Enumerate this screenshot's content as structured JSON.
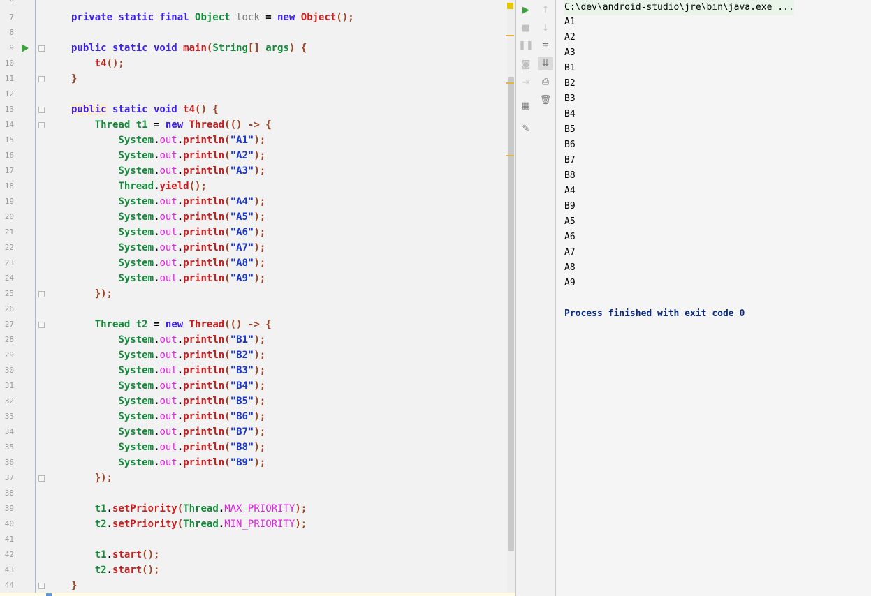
{
  "editor": {
    "first_line_number": "6",
    "lines": [
      {
        "n": "7",
        "tokens": [
          [
            "kw",
            "private static final "
          ],
          [
            "tp",
            "Object "
          ],
          [
            "var",
            "lock "
          ],
          [
            "op",
            "= "
          ],
          [
            "kw",
            "new "
          ],
          [
            "fn",
            "Object"
          ],
          [
            "pn",
            "();"
          ]
        ]
      },
      {
        "n": "8",
        "tokens": []
      },
      {
        "n": "9",
        "tokens": [
          [
            "kw",
            "public static void "
          ],
          [
            "fn",
            "main"
          ],
          [
            "pn",
            "("
          ],
          [
            "tp",
            "String"
          ],
          [
            "pn",
            "[] "
          ],
          [
            "tp",
            "args"
          ],
          [
            "pn",
            ") {"
          ]
        ]
      },
      {
        "n": "10",
        "tokens": [
          [
            "op",
            "    "
          ],
          [
            "fn",
            "t4"
          ],
          [
            "pn",
            "();"
          ]
        ]
      },
      {
        "n": "11",
        "tokens": [
          [
            "pn",
            "}"
          ]
        ]
      },
      {
        "n": "12",
        "tokens": []
      },
      {
        "n": "13",
        "tokens": [
          [
            "kwhl",
            "public"
          ],
          [
            "kw",
            " static void "
          ],
          [
            "fn",
            "t4"
          ],
          [
            "pn",
            "() {"
          ]
        ]
      },
      {
        "n": "14",
        "tokens": [
          [
            "op",
            "    "
          ],
          [
            "tp",
            "Thread "
          ],
          [
            "tp",
            "t1 "
          ],
          [
            "op",
            "= "
          ],
          [
            "kw",
            "new "
          ],
          [
            "fn",
            "Thread"
          ],
          [
            "pn",
            "(() -> {"
          ]
        ]
      },
      {
        "n": "15",
        "tokens": [
          [
            "op",
            "        "
          ],
          [
            "tp",
            "System"
          ],
          [
            "op",
            "."
          ],
          [
            "fld",
            "out"
          ],
          [
            "op",
            "."
          ],
          [
            "fn",
            "println"
          ],
          [
            "pn",
            "("
          ],
          [
            "str",
            "\"A1\""
          ],
          [
            "pn",
            ");"
          ]
        ]
      },
      {
        "n": "16",
        "tokens": [
          [
            "op",
            "        "
          ],
          [
            "tp",
            "System"
          ],
          [
            "op",
            "."
          ],
          [
            "fld",
            "out"
          ],
          [
            "op",
            "."
          ],
          [
            "fn",
            "println"
          ],
          [
            "pn",
            "("
          ],
          [
            "str",
            "\"A2\""
          ],
          [
            "pn",
            ");"
          ]
        ]
      },
      {
        "n": "17",
        "tokens": [
          [
            "op",
            "        "
          ],
          [
            "tp",
            "System"
          ],
          [
            "op",
            "."
          ],
          [
            "fld",
            "out"
          ],
          [
            "op",
            "."
          ],
          [
            "fn",
            "println"
          ],
          [
            "pn",
            "("
          ],
          [
            "str",
            "\"A3\""
          ],
          [
            "pn",
            ");"
          ]
        ]
      },
      {
        "n": "18",
        "tokens": [
          [
            "op",
            "        "
          ],
          [
            "tp",
            "Thread"
          ],
          [
            "op",
            "."
          ],
          [
            "fn",
            "yield"
          ],
          [
            "pn",
            "();"
          ]
        ]
      },
      {
        "n": "19",
        "tokens": [
          [
            "op",
            "        "
          ],
          [
            "tp",
            "System"
          ],
          [
            "op",
            "."
          ],
          [
            "fld",
            "out"
          ],
          [
            "op",
            "."
          ],
          [
            "fn",
            "println"
          ],
          [
            "pn",
            "("
          ],
          [
            "str",
            "\"A4\""
          ],
          [
            "pn",
            ");"
          ]
        ]
      },
      {
        "n": "20",
        "tokens": [
          [
            "op",
            "        "
          ],
          [
            "tp",
            "System"
          ],
          [
            "op",
            "."
          ],
          [
            "fld",
            "out"
          ],
          [
            "op",
            "."
          ],
          [
            "fn",
            "println"
          ],
          [
            "pn",
            "("
          ],
          [
            "str",
            "\"A5\""
          ],
          [
            "pn",
            ");"
          ]
        ]
      },
      {
        "n": "21",
        "tokens": [
          [
            "op",
            "        "
          ],
          [
            "tp",
            "System"
          ],
          [
            "op",
            "."
          ],
          [
            "fld",
            "out"
          ],
          [
            "op",
            "."
          ],
          [
            "fn",
            "println"
          ],
          [
            "pn",
            "("
          ],
          [
            "str",
            "\"A6\""
          ],
          [
            "pn",
            ");"
          ]
        ]
      },
      {
        "n": "22",
        "tokens": [
          [
            "op",
            "        "
          ],
          [
            "tp",
            "System"
          ],
          [
            "op",
            "."
          ],
          [
            "fld",
            "out"
          ],
          [
            "op",
            "."
          ],
          [
            "fn",
            "println"
          ],
          [
            "pn",
            "("
          ],
          [
            "str",
            "\"A7\""
          ],
          [
            "pn",
            ");"
          ]
        ]
      },
      {
        "n": "23",
        "tokens": [
          [
            "op",
            "        "
          ],
          [
            "tp",
            "System"
          ],
          [
            "op",
            "."
          ],
          [
            "fld",
            "out"
          ],
          [
            "op",
            "."
          ],
          [
            "fn",
            "println"
          ],
          [
            "pn",
            "("
          ],
          [
            "str",
            "\"A8\""
          ],
          [
            "pn",
            ");"
          ]
        ]
      },
      {
        "n": "24",
        "tokens": [
          [
            "op",
            "        "
          ],
          [
            "tp",
            "System"
          ],
          [
            "op",
            "."
          ],
          [
            "fld",
            "out"
          ],
          [
            "op",
            "."
          ],
          [
            "fn",
            "println"
          ],
          [
            "pn",
            "("
          ],
          [
            "str",
            "\"A9\""
          ],
          [
            "pn",
            ");"
          ]
        ]
      },
      {
        "n": "25",
        "tokens": [
          [
            "op",
            "    "
          ],
          [
            "pn",
            "});"
          ]
        ]
      },
      {
        "n": "26",
        "tokens": []
      },
      {
        "n": "27",
        "tokens": [
          [
            "op",
            "    "
          ],
          [
            "tp",
            "Thread "
          ],
          [
            "tp",
            "t2 "
          ],
          [
            "op",
            "= "
          ],
          [
            "kw",
            "new "
          ],
          [
            "fn",
            "Thread"
          ],
          [
            "pn",
            "(() -> {"
          ]
        ]
      },
      {
        "n": "28",
        "tokens": [
          [
            "op",
            "        "
          ],
          [
            "tp",
            "System"
          ],
          [
            "op",
            "."
          ],
          [
            "fld",
            "out"
          ],
          [
            "op",
            "."
          ],
          [
            "fn",
            "println"
          ],
          [
            "pn",
            "("
          ],
          [
            "str",
            "\"B1\""
          ],
          [
            "pn",
            ");"
          ]
        ]
      },
      {
        "n": "29",
        "tokens": [
          [
            "op",
            "        "
          ],
          [
            "tp",
            "System"
          ],
          [
            "op",
            "."
          ],
          [
            "fld",
            "out"
          ],
          [
            "op",
            "."
          ],
          [
            "fn",
            "println"
          ],
          [
            "pn",
            "("
          ],
          [
            "str",
            "\"B2\""
          ],
          [
            "pn",
            ");"
          ]
        ]
      },
      {
        "n": "30",
        "tokens": [
          [
            "op",
            "        "
          ],
          [
            "tp",
            "System"
          ],
          [
            "op",
            "."
          ],
          [
            "fld",
            "out"
          ],
          [
            "op",
            "."
          ],
          [
            "fn",
            "println"
          ],
          [
            "pn",
            "("
          ],
          [
            "str",
            "\"B3\""
          ],
          [
            "pn",
            ");"
          ]
        ]
      },
      {
        "n": "31",
        "tokens": [
          [
            "op",
            "        "
          ],
          [
            "tp",
            "System"
          ],
          [
            "op",
            "."
          ],
          [
            "fld",
            "out"
          ],
          [
            "op",
            "."
          ],
          [
            "fn",
            "println"
          ],
          [
            "pn",
            "("
          ],
          [
            "str",
            "\"B4\""
          ],
          [
            "pn",
            ");"
          ]
        ]
      },
      {
        "n": "32",
        "tokens": [
          [
            "op",
            "        "
          ],
          [
            "tp",
            "System"
          ],
          [
            "op",
            "."
          ],
          [
            "fld",
            "out"
          ],
          [
            "op",
            "."
          ],
          [
            "fn",
            "println"
          ],
          [
            "pn",
            "("
          ],
          [
            "str",
            "\"B5\""
          ],
          [
            "pn",
            ");"
          ]
        ]
      },
      {
        "n": "33",
        "tokens": [
          [
            "op",
            "        "
          ],
          [
            "tp",
            "System"
          ],
          [
            "op",
            "."
          ],
          [
            "fld",
            "out"
          ],
          [
            "op",
            "."
          ],
          [
            "fn",
            "println"
          ],
          [
            "pn",
            "("
          ],
          [
            "str",
            "\"B6\""
          ],
          [
            "pn",
            ");"
          ]
        ]
      },
      {
        "n": "34",
        "tokens": [
          [
            "op",
            "        "
          ],
          [
            "tp",
            "System"
          ],
          [
            "op",
            "."
          ],
          [
            "fld",
            "out"
          ],
          [
            "op",
            "."
          ],
          [
            "fn",
            "println"
          ],
          [
            "pn",
            "("
          ],
          [
            "str",
            "\"B7\""
          ],
          [
            "pn",
            ");"
          ]
        ]
      },
      {
        "n": "35",
        "tokens": [
          [
            "op",
            "        "
          ],
          [
            "tp",
            "System"
          ],
          [
            "op",
            "."
          ],
          [
            "fld",
            "out"
          ],
          [
            "op",
            "."
          ],
          [
            "fn",
            "println"
          ],
          [
            "pn",
            "("
          ],
          [
            "str",
            "\"B8\""
          ],
          [
            "pn",
            ");"
          ]
        ]
      },
      {
        "n": "36",
        "tokens": [
          [
            "op",
            "        "
          ],
          [
            "tp",
            "System"
          ],
          [
            "op",
            "."
          ],
          [
            "fld",
            "out"
          ],
          [
            "op",
            "."
          ],
          [
            "fn",
            "println"
          ],
          [
            "pn",
            "("
          ],
          [
            "str",
            "\"B9\""
          ],
          [
            "pn",
            ");"
          ]
        ]
      },
      {
        "n": "37",
        "tokens": [
          [
            "op",
            "    "
          ],
          [
            "pn",
            "});"
          ]
        ]
      },
      {
        "n": "38",
        "tokens": []
      },
      {
        "n": "39",
        "tokens": [
          [
            "op",
            "    "
          ],
          [
            "tp",
            "t1"
          ],
          [
            "op",
            "."
          ],
          [
            "fn",
            "setPriority"
          ],
          [
            "pn",
            "("
          ],
          [
            "tp",
            "Thread"
          ],
          [
            "op",
            "."
          ],
          [
            "cst",
            "MAX_PRIORITY"
          ],
          [
            "pn",
            ");"
          ]
        ]
      },
      {
        "n": "40",
        "tokens": [
          [
            "op",
            "    "
          ],
          [
            "tp",
            "t2"
          ],
          [
            "op",
            "."
          ],
          [
            "fn",
            "setPriority"
          ],
          [
            "pn",
            "("
          ],
          [
            "tp",
            "Thread"
          ],
          [
            "op",
            "."
          ],
          [
            "cst",
            "MIN_PRIORITY"
          ],
          [
            "pn",
            ");"
          ]
        ]
      },
      {
        "n": "41",
        "tokens": []
      },
      {
        "n": "42",
        "tokens": [
          [
            "op",
            "    "
          ],
          [
            "tp",
            "t1"
          ],
          [
            "op",
            "."
          ],
          [
            "fn",
            "start"
          ],
          [
            "pn",
            "();"
          ]
        ]
      },
      {
        "n": "43",
        "tokens": [
          [
            "op",
            "    "
          ],
          [
            "tp",
            "t2"
          ],
          [
            "op",
            "."
          ],
          [
            "fn",
            "start"
          ],
          [
            "pn",
            "();"
          ]
        ]
      },
      {
        "n": "44",
        "tokens": [
          [
            "pn",
            "}"
          ]
        ]
      }
    ]
  },
  "toolbar": {
    "rerun_icon": "run-icon",
    "stop_icon": "stop-icon",
    "pause_icon": "pause-icon",
    "dump_icon": "camera-icon",
    "exit_icon": "exit-icon",
    "layout_icon": "layout-icon",
    "pin_icon": "pin-icon",
    "up_icon": "arrow-up-icon",
    "down_icon": "arrow-down-icon",
    "wrap_icon": "soft-wrap-icon",
    "scroll_end_icon": "scroll-to-end-icon",
    "print_icon": "print-icon",
    "clear_icon": "trash-icon"
  },
  "console": {
    "command": "C:\\dev\\android-studio\\jre\\bin\\java.exe ...",
    "output": [
      "A1",
      "A2",
      "A3",
      "B1",
      "B2",
      "B3",
      "B4",
      "B5",
      "B6",
      "B7",
      "B8",
      "A4",
      "B9",
      "A5",
      "A6",
      "A7",
      "A8",
      "A9"
    ],
    "finished": "Process finished with exit code 0"
  },
  "colors": {
    "keyword": "#3b1ef0",
    "type": "#138a3a",
    "method": "#cc1b1b",
    "string": "#1a37cc",
    "field": "#e020e0",
    "finished_text": "#0a2a82"
  }
}
